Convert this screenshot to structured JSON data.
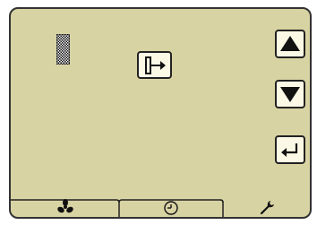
{
  "controls": {
    "checker_pattern": "checker-pattern",
    "door_exit": "door-exit-icon",
    "up": "up-arrow-icon",
    "down": "down-arrow-icon",
    "enter": "enter-icon"
  },
  "tabs": [
    {
      "icon": "fan-icon"
    },
    {
      "icon": "clock-icon"
    },
    {
      "icon": "wrench-icon"
    }
  ],
  "colors": {
    "panel_bg": "#d8d3a3",
    "button_bg": "#fbf9e6",
    "outline": "#222222"
  }
}
